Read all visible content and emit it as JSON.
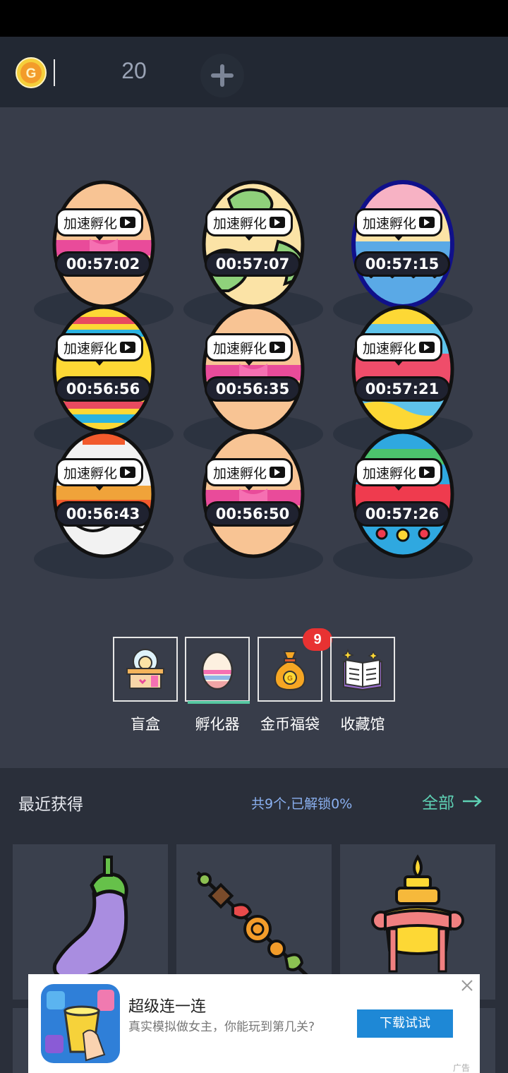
{
  "header": {
    "coin_icon": "gold-coin-icon",
    "coin_count": "20",
    "add_icon": "plus-icon"
  },
  "eggs": [
    {
      "action_label": "加速孵化",
      "timer": "00:57:02",
      "style": "peach-bow"
    },
    {
      "action_label": "加速孵化",
      "timer": "00:57:07",
      "style": "cream-green-swirl"
    },
    {
      "action_label": "加速孵化",
      "timer": "00:57:15",
      "style": "pink-blue-zigzag"
    },
    {
      "action_label": "加速孵化",
      "timer": "00:56:56",
      "style": "yellow-stripes"
    },
    {
      "action_label": "加速孵化",
      "timer": "00:56:35",
      "style": "peach-bow"
    },
    {
      "action_label": "加速孵化",
      "timer": "00:57:21",
      "style": "blue-red-pattern"
    },
    {
      "action_label": "加速孵化",
      "timer": "00:56:43",
      "style": "white-orange-dots"
    },
    {
      "action_label": "加速孵化",
      "timer": "00:56:50",
      "style": "peach-bow"
    },
    {
      "action_label": "加速孵化",
      "timer": "00:57:26",
      "style": "blue-green-red"
    }
  ],
  "nav": {
    "tabs": [
      {
        "label": "盲盒",
        "icon": "blind-box-icon"
      },
      {
        "label": "孵化器",
        "icon": "egg-incubator-icon",
        "active": true
      },
      {
        "label": "金币福袋",
        "icon": "coin-bag-icon",
        "badge": "9"
      },
      {
        "label": "收藏馆",
        "icon": "collection-book-icon"
      }
    ]
  },
  "recent": {
    "title": "最近获得",
    "stats": "共9个,已解锁0%",
    "view_all": "全部",
    "items": [
      {
        "icon": "eggplant-icon"
      },
      {
        "icon": "skewer-icon"
      },
      {
        "icon": "treasure-vase-icon"
      }
    ]
  },
  "ad": {
    "title": "超级连一连",
    "description": "真实模拟做女主，你能玩到第几关?",
    "button": "下载试试",
    "mark": "广告",
    "close_icon": "close-icon"
  },
  "colors": {
    "background": "#383d4a",
    "top_bar": "#222833",
    "accent_green": "#55c7a0",
    "link_blue": "#8ab0f0",
    "badge_red": "#e83232",
    "ad_button": "#1e88d6"
  }
}
